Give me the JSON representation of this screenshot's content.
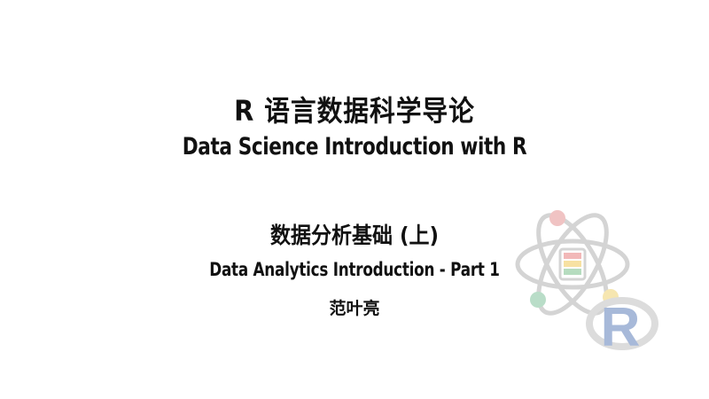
{
  "slide": {
    "title_cn": "R 语言数据科学导论",
    "title_en": "Data Science Introduction with R",
    "subtitle_cn": "数据分析基础 (上)",
    "subtitle_en": "Data Analytics Introduction - Part 1",
    "author": "范叶亮"
  },
  "logo": {
    "icon": "atom-data-r-logo",
    "letter": "R",
    "colors": {
      "orbit": "#d4d4d4",
      "electron_red": "#f0c3c3",
      "electron_green": "#b9ddc8",
      "electron_yellow": "#f6e6b0",
      "layer_red": "#f2b8b8",
      "layer_yellow": "#f7e1a2",
      "layer_green": "#b6dcbf",
      "r_blue": "#a7b9d9",
      "r_ring": "#dcdcdc"
    }
  }
}
